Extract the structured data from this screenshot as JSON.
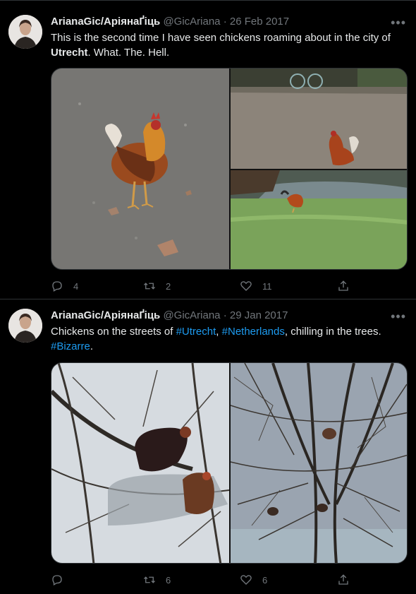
{
  "tweets": [
    {
      "author_name": "ArianaGic/АріянаҐіць",
      "handle": "@GicAriana",
      "dot": "·",
      "date": "26 Feb 2017",
      "more": "•••",
      "text_parts": [
        "This is the second time I have seen chickens roaming about in the city of ",
        "Utrecht",
        ". What. The. Hell."
      ],
      "replies": "4",
      "retweets": "2",
      "likes": "11",
      "photos": [
        "rooster-on-pavement-photo",
        "rooster-in-park-photo",
        "rooster-by-pond-photo"
      ]
    },
    {
      "author_name": "ArianaGic/АріянаҐіць",
      "handle": "@GicAriana",
      "dot": "·",
      "date": "29 Jan 2017",
      "more": "•••",
      "text_parts": [
        "Chickens on the streets of ",
        "#Utrecht",
        ", ",
        "#Netherlands",
        ", chilling in the trees.",
        "#Bizarre",
        "."
      ],
      "replies": "",
      "retweets": "6",
      "likes": "6",
      "photos": [
        "chickens-in-tree-photo",
        "bare-tree-branches-photo"
      ]
    }
  ],
  "icons": [
    "reply-icon",
    "retweet-icon",
    "like-icon",
    "share-icon",
    "more-icon"
  ],
  "colors": {
    "background": "#000000",
    "text": "#e7e9ea",
    "muted": "#71767b",
    "link": "#1d9bf0",
    "divider": "#2f3336"
  }
}
